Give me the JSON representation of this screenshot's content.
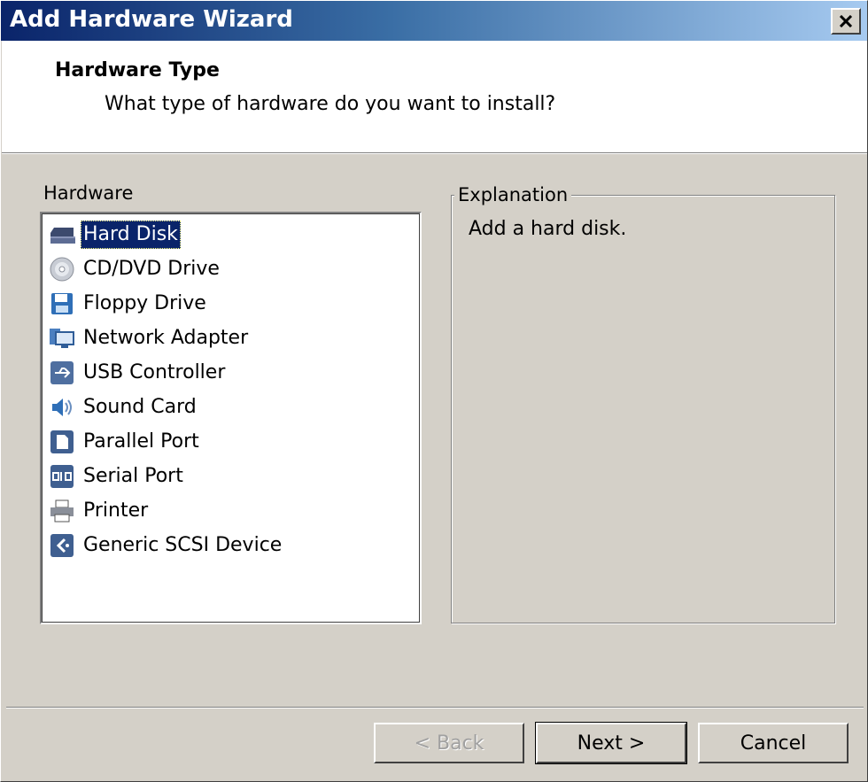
{
  "window": {
    "title": "Add Hardware Wizard",
    "close_symbol": "×"
  },
  "header": {
    "title": "Hardware Type",
    "subtitle": "What type of hardware do you want to install?"
  },
  "hardware": {
    "label": "Hardware",
    "selected_index": 0,
    "items": [
      {
        "label": "Hard Disk",
        "icon": "hard-disk-icon"
      },
      {
        "label": "CD/DVD Drive",
        "icon": "cd-dvd-icon"
      },
      {
        "label": "Floppy Drive",
        "icon": "floppy-icon"
      },
      {
        "label": "Network Adapter",
        "icon": "network-adapter-icon"
      },
      {
        "label": "USB Controller",
        "icon": "usb-icon"
      },
      {
        "label": "Sound Card",
        "icon": "sound-card-icon"
      },
      {
        "label": "Parallel Port",
        "icon": "parallel-port-icon"
      },
      {
        "label": "Serial Port",
        "icon": "serial-port-icon"
      },
      {
        "label": "Printer",
        "icon": "printer-icon"
      },
      {
        "label": "Generic SCSI Device",
        "icon": "scsi-icon"
      }
    ]
  },
  "explanation": {
    "legend": "Explanation",
    "text": "Add a hard disk."
  },
  "buttons": {
    "back": "< Back",
    "next": "Next >",
    "cancel": "Cancel"
  },
  "colors": {
    "selection": "#0a246a",
    "title_gradient_start": "#0a246a",
    "title_gradient_end": "#a6caf0",
    "face": "#d4d0c8"
  }
}
